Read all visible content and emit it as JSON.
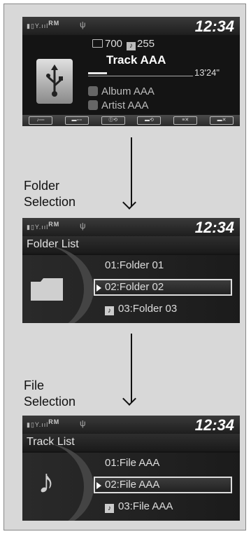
{
  "status": {
    "signal": "RM",
    "time": "12:34"
  },
  "main": {
    "folder_count": "700",
    "track_count": "255",
    "track": "Track AAA",
    "elapsed": "13'24\"",
    "album": "Album AAA",
    "artist": "Artist AAA",
    "progress": 0.18,
    "softkeys": [
      "♪▫▫▫",
      "▬▫▫▫",
      "⓵⟲",
      "▬⟲",
      "≡✕",
      "▬✕"
    ]
  },
  "steps": {
    "folder": [
      "Folder",
      "Selection"
    ],
    "file": [
      "File",
      "Selection"
    ]
  },
  "folder_list": {
    "title": "Folder List",
    "items": [
      "01:Folder 01",
      "02:Folder 02",
      "03:Folder 03"
    ]
  },
  "track_list": {
    "title": "Track List",
    "items": [
      "01:File AAA",
      "02:File AAA",
      "03:File AAA"
    ]
  },
  "colors": {
    "screen_bg": "#141414",
    "frame_bg": "#d8d8d8"
  }
}
